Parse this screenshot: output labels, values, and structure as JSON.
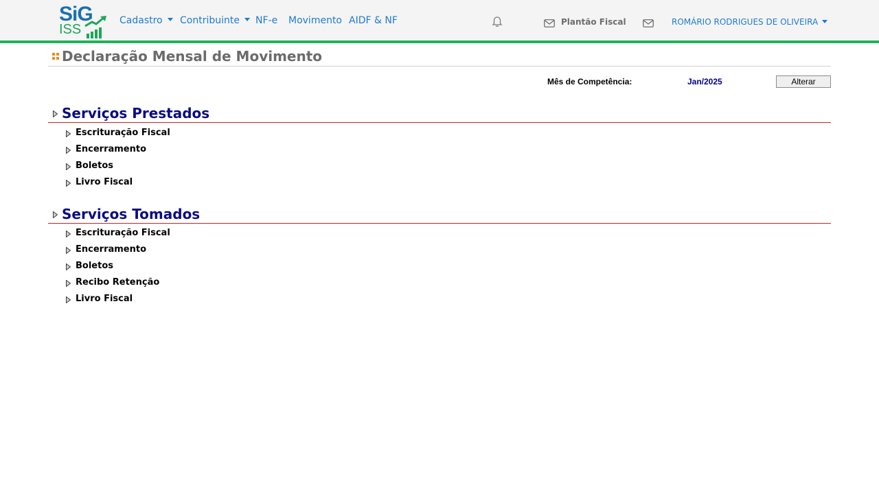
{
  "brand": {
    "logo_top": "SiG",
    "logo_bottom": "ISS"
  },
  "nav": {
    "items": [
      {
        "label": "Cadastro",
        "dropdown": true
      },
      {
        "label": "Contribuinte",
        "dropdown": true
      },
      {
        "label": "NF-e",
        "dropdown": false
      },
      {
        "label": "Movimento",
        "dropdown": false
      },
      {
        "label": "AIDF & NF",
        "dropdown": false
      }
    ],
    "plantao_label": "Plantão Fiscal",
    "user_name": "ROMÁRIO RODRIGUES DE OLIVEIRA",
    "icons": [
      "bell-icon",
      "envelope-icon",
      "envelope-icon"
    ]
  },
  "page": {
    "title": "Declaração Mensal de Movimento",
    "competencia_label": "Mês de Competência:",
    "competencia_value": "Jan/2025",
    "alterar_label": "Alterar"
  },
  "sections": [
    {
      "title": "Serviços Prestados",
      "items": [
        "Escrituração Fiscal",
        "Encerramento",
        "Boletos",
        "Livro Fiscal"
      ]
    },
    {
      "title": "Serviços Tomados",
      "items": [
        "Escrituração Fiscal",
        "Encerramento",
        "Boletos",
        "Recibo Retenção",
        "Livro Fiscal"
      ]
    }
  ],
  "colors": {
    "accent_green": "#1fb25a",
    "link_blue": "#1e7bd0",
    "section_title": "#0b0b82",
    "section_rule": "#d11f1f",
    "title_icon": "#f08a1d"
  }
}
